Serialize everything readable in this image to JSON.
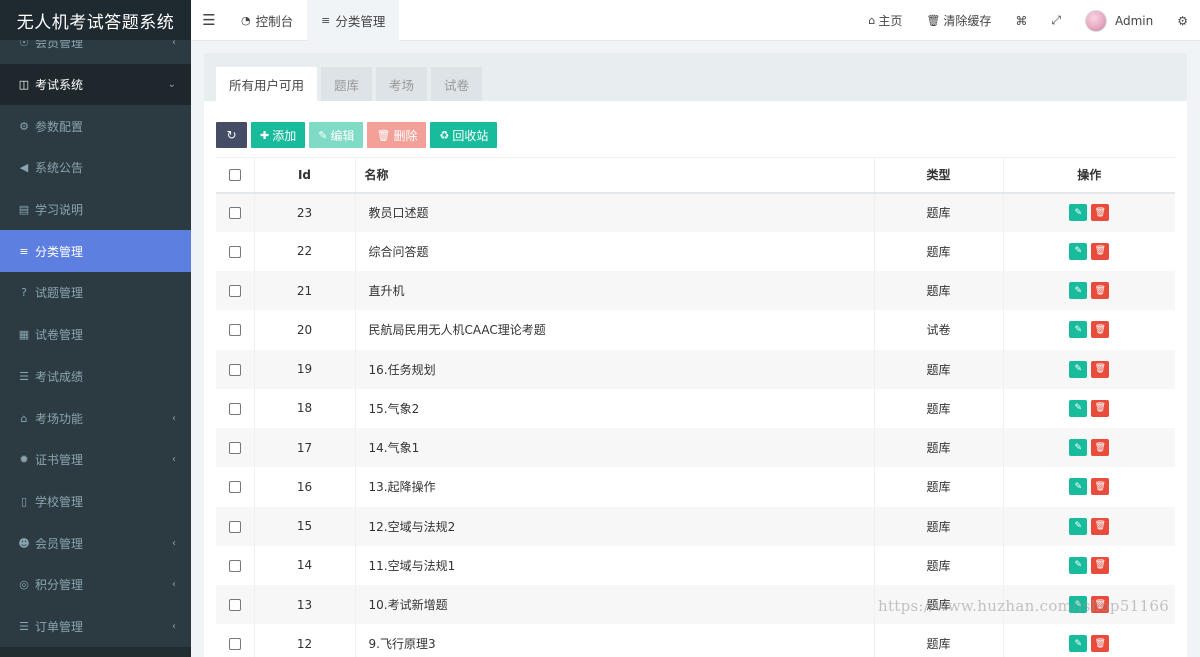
{
  "app": {
    "title": "无人机考试答题系统"
  },
  "sidebar": {
    "items": [
      {
        "label": "会员管理",
        "icon": "gauge-icon",
        "glyph": "☉",
        "type": "sub",
        "caret": "‹"
      },
      {
        "label": "考试系统",
        "icon": "columns-icon",
        "glyph": "◫",
        "type": "open",
        "caret": "⌄"
      },
      {
        "label": "参数配置",
        "icon": "cogs-icon",
        "glyph": "⚙",
        "type": "sub",
        "caret": ""
      },
      {
        "label": "系统公告",
        "icon": "volume-icon",
        "glyph": "◀",
        "type": "sub",
        "caret": ""
      },
      {
        "label": "学习说明",
        "icon": "map-icon",
        "glyph": "▤",
        "type": "sub",
        "caret": ""
      },
      {
        "label": "分类管理",
        "icon": "align-left-icon",
        "glyph": "≡",
        "type": "active",
        "caret": ""
      },
      {
        "label": "试题管理",
        "icon": "question-circle-icon",
        "glyph": "?",
        "type": "sub",
        "caret": ""
      },
      {
        "label": "试卷管理",
        "icon": "keyboard-icon",
        "glyph": "▦",
        "type": "sub",
        "caret": ""
      },
      {
        "label": "考试成绩",
        "icon": "list-icon",
        "glyph": "☰",
        "type": "sub",
        "caret": ""
      },
      {
        "label": "考场功能",
        "icon": "home-icon",
        "glyph": "⌂",
        "type": "sub",
        "caret": "‹"
      },
      {
        "label": "证书管理",
        "icon": "certificate-icon",
        "glyph": "✹",
        "type": "sub",
        "caret": "‹"
      },
      {
        "label": "学校管理",
        "icon": "building-icon",
        "glyph": "▯",
        "type": "sub",
        "caret": ""
      },
      {
        "label": "会员管理",
        "icon": "user-circle-icon",
        "glyph": "☻",
        "type": "sub",
        "caret": "‹"
      },
      {
        "label": "积分管理",
        "icon": "lifebuoy-icon",
        "glyph": "◎",
        "type": "sub",
        "caret": "‹"
      },
      {
        "label": "订单管理",
        "icon": "list-ul-icon",
        "glyph": "☰",
        "type": "sub",
        "caret": "‹"
      }
    ]
  },
  "topbar": {
    "tabs": [
      {
        "label": "控制台",
        "icon": "dashboard-icon",
        "glyph": "◔"
      },
      {
        "label": "分类管理",
        "icon": "align-left-icon",
        "glyph": "≡"
      }
    ],
    "home_label": "主页",
    "clear_cache_label": "清除缓存",
    "user_label": "Admin"
  },
  "panel": {
    "tabs": [
      "所有用户可用",
      "题库",
      "考场",
      "试卷"
    ]
  },
  "toolbar": {
    "add_label": "添加",
    "edit_label": "编辑",
    "delete_label": "删除",
    "recycle_label": "回收站"
  },
  "table": {
    "headers": {
      "id": "Id",
      "name": "名称",
      "type": "类型",
      "ops": "操作"
    },
    "rows": [
      {
        "id": "23",
        "name": "教员口述题",
        "type": "题库"
      },
      {
        "id": "22",
        "name": "综合问答题",
        "type": "题库"
      },
      {
        "id": "21",
        "name": "直升机",
        "type": "题库"
      },
      {
        "id": "20",
        "name": "民航局民用无人机CAAC理论考题",
        "type": "试卷"
      },
      {
        "id": "19",
        "name": "16.任务规划",
        "type": "题库"
      },
      {
        "id": "18",
        "name": "15.气象2",
        "type": "题库"
      },
      {
        "id": "17",
        "name": "14.气象1",
        "type": "题库"
      },
      {
        "id": "16",
        "name": "13.起降操作",
        "type": "题库"
      },
      {
        "id": "15",
        "name": "12.空域与法规2",
        "type": "题库"
      },
      {
        "id": "14",
        "name": "11.空域与法规1",
        "type": "题库"
      },
      {
        "id": "13",
        "name": "10.考试新增题",
        "type": "题库"
      },
      {
        "id": "12",
        "name": "9.飞行原理3",
        "type": "题库"
      }
    ]
  },
  "watermark": "https://www.huzhan.com/ishop51166"
}
